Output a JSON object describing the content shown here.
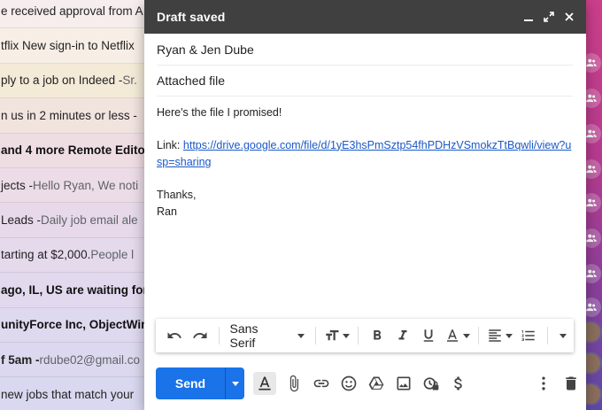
{
  "inbox": {
    "rows": [
      {
        "subject": "e received approval from A",
        "snippet": "",
        "bold": false,
        "bg": "#f6eeec"
      },
      {
        "subject": "tflix New sign-in to Netflix",
        "snippet": "",
        "bold": false,
        "bg": "#f7efe6"
      },
      {
        "subject": "ply to a job on Indeed - ",
        "snippet": "Sr.",
        "bold": false,
        "bg": "#f4ead8"
      },
      {
        "subject": "n us in 2 minutes or less - ",
        "snippet": "",
        "bold": false,
        "bg": "#f1e3de"
      },
      {
        "subject": "and 4 more Remote Edito",
        "snippet": "",
        "bold": true,
        "bg": "#efdde4"
      },
      {
        "subject": "jects - ",
        "snippet": "Hello Ryan, We noti",
        "bold": false,
        "bg": "#ecdce8"
      },
      {
        "subject": "Leads - ",
        "snippet": "Daily job email ale",
        "bold": false,
        "bg": "#e7d9ea"
      },
      {
        "subject": "tarting at $2,000. ",
        "snippet": "People l",
        "bold": false,
        "bg": "#e5daec"
      },
      {
        "subject": "ago, IL, US are waiting for",
        "snippet": "",
        "bold": true,
        "bg": "#e3d9ee"
      },
      {
        "subject": "unityForce Inc, ObjectWin",
        "snippet": "",
        "bold": true,
        "bg": "#dfd9ef"
      },
      {
        "subject": "f 5am - ",
        "snippet": "rdube02@gmail.co",
        "bold": false,
        "bg": "#dcd8ef",
        "subject_bold": true
      },
      {
        "subject": "new jobs that match your",
        "snippet": "",
        "bold": false,
        "bg": "#d9d8f0"
      }
    ]
  },
  "compose": {
    "title": "Draft saved",
    "to": "Ryan & Jen Dube",
    "subject": "Attached file",
    "body_line1": "Here's the file I promised!",
    "link_label": "Link: ",
    "link_url": "https://drive.google.com/file/d/1yE3hsPmSztp54fhPDHzVSmokzTtBqwli/view?usp=sharing",
    "closing": "Thanks,",
    "signature": "Ran"
  },
  "toolbar": {
    "font": "Sans Serif",
    "icons": [
      "undo-icon",
      "redo-icon",
      "text-size-icon",
      "bold-icon",
      "italic-icon",
      "underline-icon",
      "text-color-icon",
      "align-icon",
      "numbered-list-icon",
      "more-formatting-icon"
    ]
  },
  "bottom_bar": {
    "send_label": "Send",
    "icons": [
      "formatting-options-icon",
      "attach-icon",
      "link-icon",
      "emoji-icon",
      "drive-icon",
      "photo-icon",
      "confidential-icon",
      "dollar-icon",
      "more-options-icon",
      "trash-icon"
    ]
  },
  "colors": {
    "header_bg": "#404040",
    "send_blue": "#1a73e8",
    "link_blue": "#1a58c9"
  }
}
